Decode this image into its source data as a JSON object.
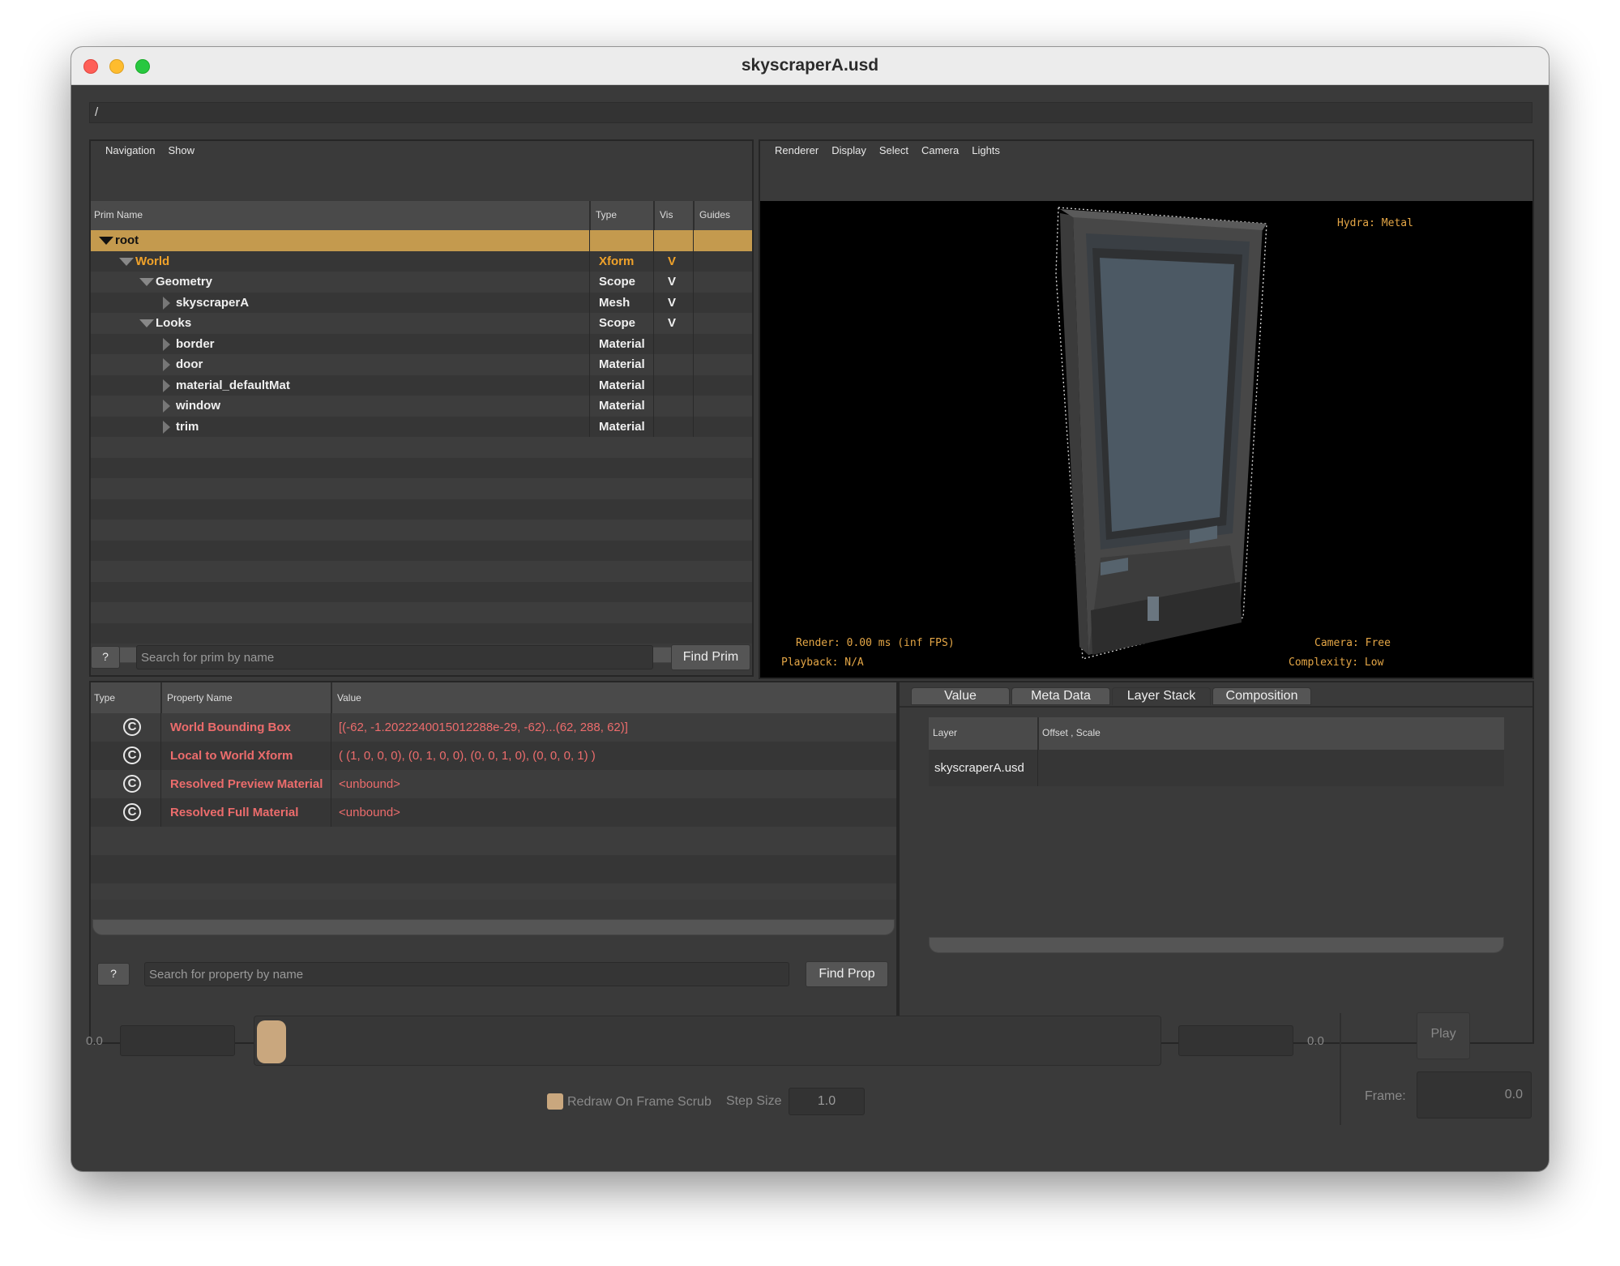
{
  "window": {
    "title": "skyscraperA.usd"
  },
  "path": "/",
  "prim_panel": {
    "menu": [
      "Navigation",
      "Show"
    ],
    "columns": {
      "name": "Prim Name",
      "type": "Type",
      "vis": "Vis",
      "guides": "Guides"
    },
    "rows": [
      {
        "name": "root",
        "type": "",
        "vis": "",
        "depth": 0,
        "expander": "down",
        "state": "selected"
      },
      {
        "name": "World",
        "type": "Xform",
        "vis": "V",
        "depth": 1,
        "expander": "down",
        "state": "highlight"
      },
      {
        "name": "Geometry",
        "type": "Scope",
        "vis": "V",
        "depth": 2,
        "expander": "down",
        "state": "normal"
      },
      {
        "name": "skyscraperA",
        "type": "Mesh",
        "vis": "V",
        "depth": 3,
        "expander": "right",
        "state": "normal"
      },
      {
        "name": "Looks",
        "type": "Scope",
        "vis": "V",
        "depth": 2,
        "expander": "down",
        "state": "normal"
      },
      {
        "name": "border",
        "type": "Material",
        "vis": "",
        "depth": 3,
        "expander": "right",
        "state": "normal"
      },
      {
        "name": "door",
        "type": "Material",
        "vis": "",
        "depth": 3,
        "expander": "right",
        "state": "normal"
      },
      {
        "name": "material_defaultMat",
        "type": "Material",
        "vis": "",
        "depth": 3,
        "expander": "right",
        "state": "normal"
      },
      {
        "name": "window",
        "type": "Material",
        "vis": "",
        "depth": 3,
        "expander": "right",
        "state": "normal"
      },
      {
        "name": "trim",
        "type": "Material",
        "vis": "",
        "depth": 3,
        "expander": "right",
        "state": "normal"
      }
    ],
    "help_label": "?",
    "search_placeholder": "Search for prim by name",
    "find_label": "Find Prim"
  },
  "viewport": {
    "menu": [
      "Renderer",
      "Display",
      "Select",
      "Camera",
      "Lights"
    ],
    "hydra": "Hydra: Metal",
    "render": "Render: 0.00 ms (inf FPS)",
    "playback": "Playback: N/A",
    "camera": "Camera: Free",
    "complexity": "Complexity: Low"
  },
  "property_panel": {
    "columns": {
      "type": "Type",
      "name": "Property Name",
      "value": "Value"
    },
    "rows": [
      {
        "icon": "C",
        "name": "World Bounding Box",
        "value": "[(-62, -1.2022240015012288e-29, -62)...(62, 288, 62)]"
      },
      {
        "icon": "C",
        "name": "Local to World Xform",
        "value": "( (1, 0, 0, 0), (0, 1, 0, 0), (0, 0, 1, 0), (0, 0, 0, 1) )"
      },
      {
        "icon": "C",
        "name": "Resolved Preview Material",
        "value": "<unbound>"
      },
      {
        "icon": "C",
        "name": "Resolved Full Material",
        "value": "<unbound>"
      }
    ],
    "help_label": "?",
    "search_placeholder": "Search for property by name",
    "find_label": "Find Prop"
  },
  "inspector": {
    "tabs": [
      "Value",
      "Meta Data",
      "Layer Stack",
      "Composition"
    ],
    "active_tab": "Layer Stack",
    "columns": {
      "layer": "Layer",
      "offset": "Offset , Scale"
    },
    "rows": [
      {
        "layer": "skyscraperA.usd",
        "offset": ""
      }
    ]
  },
  "timeline": {
    "start_value": "0.0",
    "end_value": "0.0",
    "play_label": "Play",
    "redraw_label": "Redraw On Frame Scrub",
    "redraw_checked": true,
    "step_size_label": "Step Size",
    "step_size": "1.0",
    "frame_label": "Frame:",
    "frame": "0.0"
  },
  "colors": {
    "selection": "#c49a4e",
    "accent_orange": "#f0a22a",
    "property_red": "#ec6c6c",
    "viewport_text": "#e4a646"
  }
}
